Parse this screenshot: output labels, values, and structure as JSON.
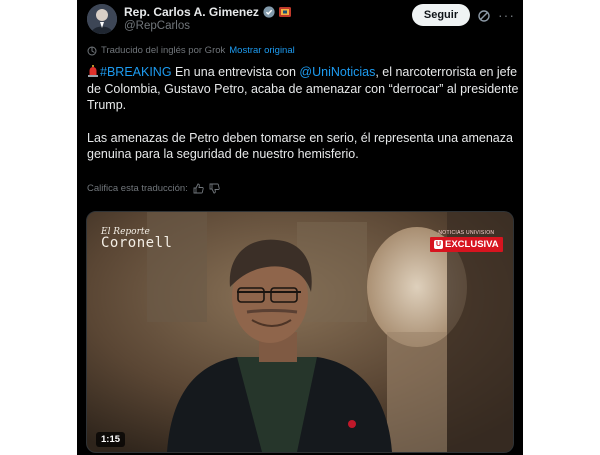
{
  "post": {
    "author_name": "Rep. Carlos A. Gimenez",
    "handle": "@RepCarlos",
    "follow_label": "Seguir",
    "more_label": "···",
    "translation_note": "Traducido del inglés por Grok",
    "show_original_label": "Mostrar original",
    "body": {
      "hashtag": "#BREAKING",
      "text_a": " En una entrevista con ",
      "mention": "@UniNoticias",
      "text_b": ", el narcoterrorista en jefe de Colombia, Gustavo Petro, acaba de amenazar con “derrocar” al presidente Trump.",
      "paragraph2": "Las amenazas de Petro deben tomarse en serio, él representa una amenaza genuina para la seguridad de nuestro hemisferio."
    },
    "rate_label": "Califica esta traducción:",
    "media": {
      "show_logo_line1": "El Reporte",
      "show_logo_line2": "Coronell",
      "network_text": "NOTICIAS UNIVISION",
      "exclusive_label": "EXCLUSIVA",
      "duration": "1:15"
    }
  },
  "colors": {
    "background": "#000000",
    "text": "#e7e9ea",
    "muted": "#71767b",
    "link": "#1d9bf0",
    "badge_red": "#d7141f"
  }
}
